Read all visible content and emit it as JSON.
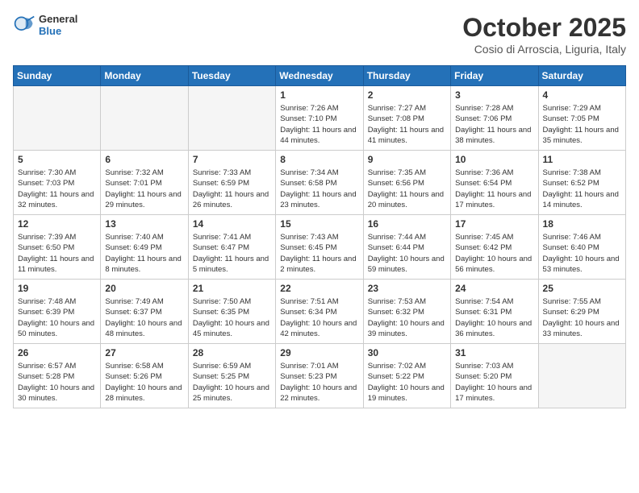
{
  "header": {
    "logo_general": "General",
    "logo_blue": "Blue",
    "month_title": "October 2025",
    "location": "Cosio di Arroscia, Liguria, Italy"
  },
  "days_of_week": [
    "Sunday",
    "Monday",
    "Tuesday",
    "Wednesday",
    "Thursday",
    "Friday",
    "Saturday"
  ],
  "weeks": [
    [
      {
        "num": "",
        "detail": ""
      },
      {
        "num": "",
        "detail": ""
      },
      {
        "num": "",
        "detail": ""
      },
      {
        "num": "1",
        "detail": "Sunrise: 7:26 AM\nSunset: 7:10 PM\nDaylight: 11 hours and 44 minutes."
      },
      {
        "num": "2",
        "detail": "Sunrise: 7:27 AM\nSunset: 7:08 PM\nDaylight: 11 hours and 41 minutes."
      },
      {
        "num": "3",
        "detail": "Sunrise: 7:28 AM\nSunset: 7:06 PM\nDaylight: 11 hours and 38 minutes."
      },
      {
        "num": "4",
        "detail": "Sunrise: 7:29 AM\nSunset: 7:05 PM\nDaylight: 11 hours and 35 minutes."
      }
    ],
    [
      {
        "num": "5",
        "detail": "Sunrise: 7:30 AM\nSunset: 7:03 PM\nDaylight: 11 hours and 32 minutes."
      },
      {
        "num": "6",
        "detail": "Sunrise: 7:32 AM\nSunset: 7:01 PM\nDaylight: 11 hours and 29 minutes."
      },
      {
        "num": "7",
        "detail": "Sunrise: 7:33 AM\nSunset: 6:59 PM\nDaylight: 11 hours and 26 minutes."
      },
      {
        "num": "8",
        "detail": "Sunrise: 7:34 AM\nSunset: 6:58 PM\nDaylight: 11 hours and 23 minutes."
      },
      {
        "num": "9",
        "detail": "Sunrise: 7:35 AM\nSunset: 6:56 PM\nDaylight: 11 hours and 20 minutes."
      },
      {
        "num": "10",
        "detail": "Sunrise: 7:36 AM\nSunset: 6:54 PM\nDaylight: 11 hours and 17 minutes."
      },
      {
        "num": "11",
        "detail": "Sunrise: 7:38 AM\nSunset: 6:52 PM\nDaylight: 11 hours and 14 minutes."
      }
    ],
    [
      {
        "num": "12",
        "detail": "Sunrise: 7:39 AM\nSunset: 6:50 PM\nDaylight: 11 hours and 11 minutes."
      },
      {
        "num": "13",
        "detail": "Sunrise: 7:40 AM\nSunset: 6:49 PM\nDaylight: 11 hours and 8 minutes."
      },
      {
        "num": "14",
        "detail": "Sunrise: 7:41 AM\nSunset: 6:47 PM\nDaylight: 11 hours and 5 minutes."
      },
      {
        "num": "15",
        "detail": "Sunrise: 7:43 AM\nSunset: 6:45 PM\nDaylight: 11 hours and 2 minutes."
      },
      {
        "num": "16",
        "detail": "Sunrise: 7:44 AM\nSunset: 6:44 PM\nDaylight: 10 hours and 59 minutes."
      },
      {
        "num": "17",
        "detail": "Sunrise: 7:45 AM\nSunset: 6:42 PM\nDaylight: 10 hours and 56 minutes."
      },
      {
        "num": "18",
        "detail": "Sunrise: 7:46 AM\nSunset: 6:40 PM\nDaylight: 10 hours and 53 minutes."
      }
    ],
    [
      {
        "num": "19",
        "detail": "Sunrise: 7:48 AM\nSunset: 6:39 PM\nDaylight: 10 hours and 50 minutes."
      },
      {
        "num": "20",
        "detail": "Sunrise: 7:49 AM\nSunset: 6:37 PM\nDaylight: 10 hours and 48 minutes."
      },
      {
        "num": "21",
        "detail": "Sunrise: 7:50 AM\nSunset: 6:35 PM\nDaylight: 10 hours and 45 minutes."
      },
      {
        "num": "22",
        "detail": "Sunrise: 7:51 AM\nSunset: 6:34 PM\nDaylight: 10 hours and 42 minutes."
      },
      {
        "num": "23",
        "detail": "Sunrise: 7:53 AM\nSunset: 6:32 PM\nDaylight: 10 hours and 39 minutes."
      },
      {
        "num": "24",
        "detail": "Sunrise: 7:54 AM\nSunset: 6:31 PM\nDaylight: 10 hours and 36 minutes."
      },
      {
        "num": "25",
        "detail": "Sunrise: 7:55 AM\nSunset: 6:29 PM\nDaylight: 10 hours and 33 minutes."
      }
    ],
    [
      {
        "num": "26",
        "detail": "Sunrise: 6:57 AM\nSunset: 5:28 PM\nDaylight: 10 hours and 30 minutes."
      },
      {
        "num": "27",
        "detail": "Sunrise: 6:58 AM\nSunset: 5:26 PM\nDaylight: 10 hours and 28 minutes."
      },
      {
        "num": "28",
        "detail": "Sunrise: 6:59 AM\nSunset: 5:25 PM\nDaylight: 10 hours and 25 minutes."
      },
      {
        "num": "29",
        "detail": "Sunrise: 7:01 AM\nSunset: 5:23 PM\nDaylight: 10 hours and 22 minutes."
      },
      {
        "num": "30",
        "detail": "Sunrise: 7:02 AM\nSunset: 5:22 PM\nDaylight: 10 hours and 19 minutes."
      },
      {
        "num": "31",
        "detail": "Sunrise: 7:03 AM\nSunset: 5:20 PM\nDaylight: 10 hours and 17 minutes."
      },
      {
        "num": "",
        "detail": ""
      }
    ]
  ]
}
